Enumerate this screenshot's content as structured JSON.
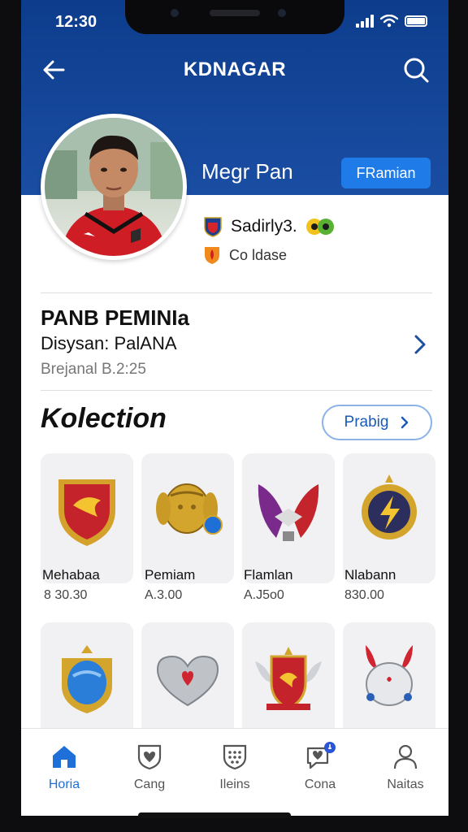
{
  "status_bar": {
    "time": "12:30"
  },
  "header": {
    "title": "KDNAGAR"
  },
  "profile": {
    "name": "Megr Pan",
    "premium_label": "FRamian",
    "meta1": "Sadirly3.",
    "meta2": "Co ldase"
  },
  "event": {
    "title": "PANB PEMINIa",
    "subtitle": "Disysan: PalANA",
    "date": "Brejanal B.2:25"
  },
  "collection": {
    "title": "Kolection",
    "button_label": "Prabig",
    "items": [
      {
        "name": "Mehabaa",
        "price": "8 30.30"
      },
      {
        "name": "Pemiam",
        "price": "A.3.00"
      },
      {
        "name": "Flamlan",
        "price": "A.J5o0"
      },
      {
        "name": "Nlabann",
        "price": "830.00"
      },
      {
        "name": "",
        "price": ""
      },
      {
        "name": "",
        "price": ""
      },
      {
        "name": "",
        "price": ""
      },
      {
        "name": "",
        "price": ""
      }
    ]
  },
  "bottom_nav": [
    {
      "label": "Horia",
      "icon": "home-icon",
      "active": true
    },
    {
      "label": "Cang",
      "icon": "shield-heart-icon",
      "active": false
    },
    {
      "label": "Ileins",
      "icon": "shield-dots-icon",
      "active": false
    },
    {
      "label": "Cona",
      "icon": "chat-heart-icon",
      "active": false
    },
    {
      "label": "Naitas",
      "icon": "user-icon",
      "active": false
    }
  ],
  "colors": {
    "header_blue": "#0d3c8c",
    "accent_blue": "#1f7be8",
    "active_nav": "#1f6fd8"
  }
}
